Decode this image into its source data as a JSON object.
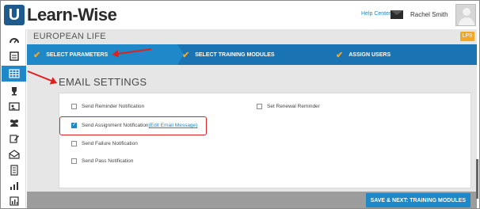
{
  "header": {
    "logo_letter": "U",
    "logo_text": "Learn-Wise",
    "help_link": "Help Center",
    "user_name": "Rachel Smith"
  },
  "sidebar": {
    "items": [
      {
        "icon": "dashboard-icon"
      },
      {
        "icon": "courses-icon"
      },
      {
        "icon": "grid-icon",
        "active": true
      },
      {
        "icon": "trophy-icon"
      },
      {
        "icon": "presentation-icon"
      },
      {
        "icon": "users-icon"
      },
      {
        "icon": "edit-icon"
      },
      {
        "icon": "mail-icon"
      },
      {
        "icon": "document-icon"
      },
      {
        "icon": "report-icon"
      },
      {
        "icon": "chart-icon"
      }
    ]
  },
  "course": {
    "title": "EUROPEAN LIFE",
    "badge": "LP9"
  },
  "steps": [
    {
      "label": "SELECT PARAMETERS"
    },
    {
      "label": "SELECT TRAINING MODULES"
    },
    {
      "label": "ASSIGN USERS"
    }
  ],
  "section": {
    "title": "EMAIL SETTINGS"
  },
  "options": {
    "reminder": {
      "label": "Send Reminder Notification",
      "checked": false
    },
    "assignment": {
      "label": "Send Assignment Notification ",
      "link": "(Edit Email Message)",
      "checked": true
    },
    "failure": {
      "label": "Send Failure Notification",
      "checked": false
    },
    "pass": {
      "label": "Send Pass Notification",
      "checked": false
    },
    "renewal": {
      "label": "Set Renewal Reminder",
      "checked": false
    }
  },
  "footer": {
    "save_label": "SAVE & NEXT: TRAINING MODULES"
  },
  "colors": {
    "accent": "#1e88c8",
    "steps_bg": "#1a74b4",
    "check": "#f5a623",
    "annotation": "#e02020"
  }
}
